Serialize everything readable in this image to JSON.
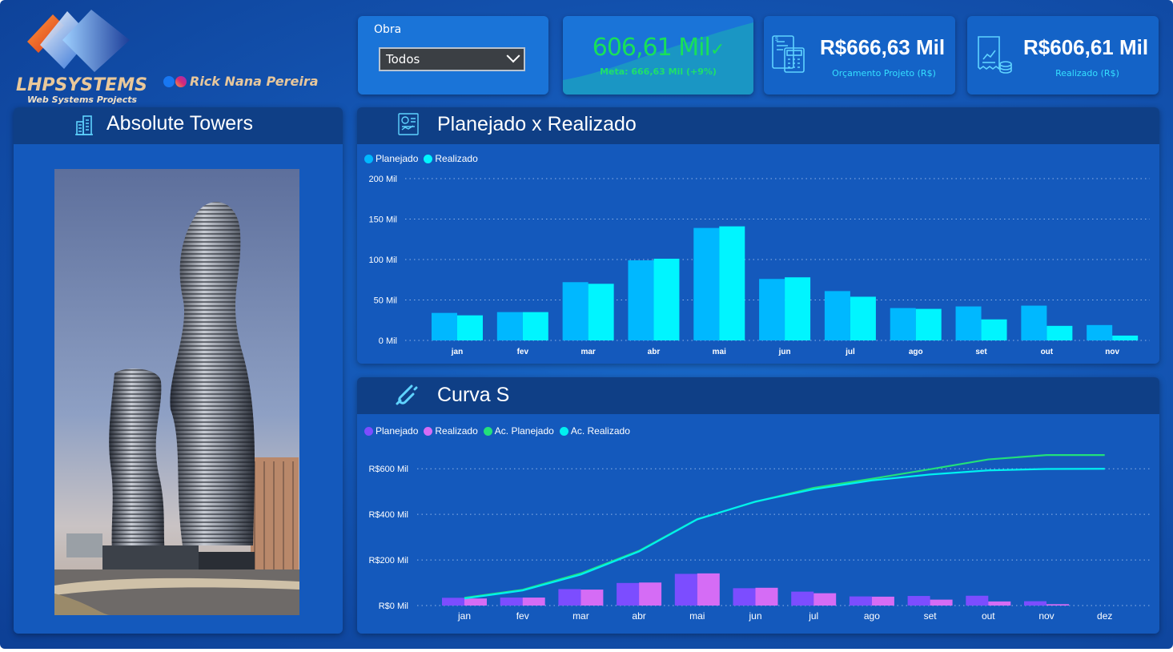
{
  "brand": {
    "logo_text": "LHPSYSTEMS",
    "logo_sub": "Web Systems Projects",
    "author": "Rick Nana Pereira"
  },
  "filter": {
    "label": "Obra",
    "selected": "Todos"
  },
  "kpis": {
    "realizado_vs_meta": {
      "value": "606,61 Mil",
      "meta": "Meta: 666,63 Mil (+9%)"
    },
    "orcamento": {
      "value": "R$666,63 Mil",
      "label": "Orçamento Projeto (R$)"
    },
    "realizado": {
      "value": "R$606,61 Mil",
      "label": "Realizado (R$)"
    }
  },
  "project": {
    "title": "Absolute Towers"
  },
  "colors": {
    "planejado": "#00b8ff",
    "realizado": "#00f5ff",
    "s_planejado": "#7c4dff",
    "s_realizado": "#d56cf5",
    "ac_planejado": "#22e07a",
    "ac_realizado": "#00f0f0"
  },
  "chart_data": [
    {
      "type": "bar",
      "title": "Planejado x Realizado",
      "categories": [
        "jan",
        "fev",
        "mar",
        "abr",
        "mai",
        "jun",
        "jul",
        "ago",
        "set",
        "out",
        "nov"
      ],
      "ylim": [
        0,
        200
      ],
      "yticks": [
        "0 Mil",
        "50 Mil",
        "100 Mil",
        "150 Mil",
        "200 Mil"
      ],
      "legend": "top-left",
      "series": [
        {
          "name": "Planejado",
          "values": [
            34,
            35,
            72,
            99,
            139,
            76,
            61,
            40,
            42,
            43,
            19
          ]
        },
        {
          "name": "Realizado",
          "values": [
            31,
            35,
            70,
            101,
            141,
            78,
            54,
            39,
            26,
            18,
            6
          ]
        }
      ]
    },
    {
      "type": "bar",
      "title": "Curva S",
      "categories": [
        "jan",
        "fev",
        "mar",
        "abr",
        "mai",
        "jun",
        "jul",
        "ago",
        "set",
        "out",
        "nov",
        "dez"
      ],
      "ylim": [
        0,
        650
      ],
      "yticks": [
        "R$0 Mil",
        "R$200 Mil",
        "R$400 Mil",
        "R$600 Mil"
      ],
      "legend": "top-left",
      "series": [
        {
          "name": "Planejado",
          "values": [
            34,
            35,
            72,
            99,
            139,
            76,
            61,
            40,
            42,
            43,
            19,
            null
          ]
        },
        {
          "name": "Realizado",
          "values": [
            31,
            35,
            70,
            101,
            141,
            78,
            54,
            39,
            26,
            18,
            6,
            null
          ]
        },
        {
          "name": "Ac. Planejado",
          "values": [
            34,
            69,
            141,
            240,
            379,
            455,
            516,
            556,
            598,
            641,
            660,
            660
          ]
        },
        {
          "name": "Ac. Realizado",
          "values": [
            31,
            66,
            136,
            237,
            378,
            456,
            510,
            549,
            575,
            593,
            599,
            600
          ]
        }
      ]
    }
  ]
}
